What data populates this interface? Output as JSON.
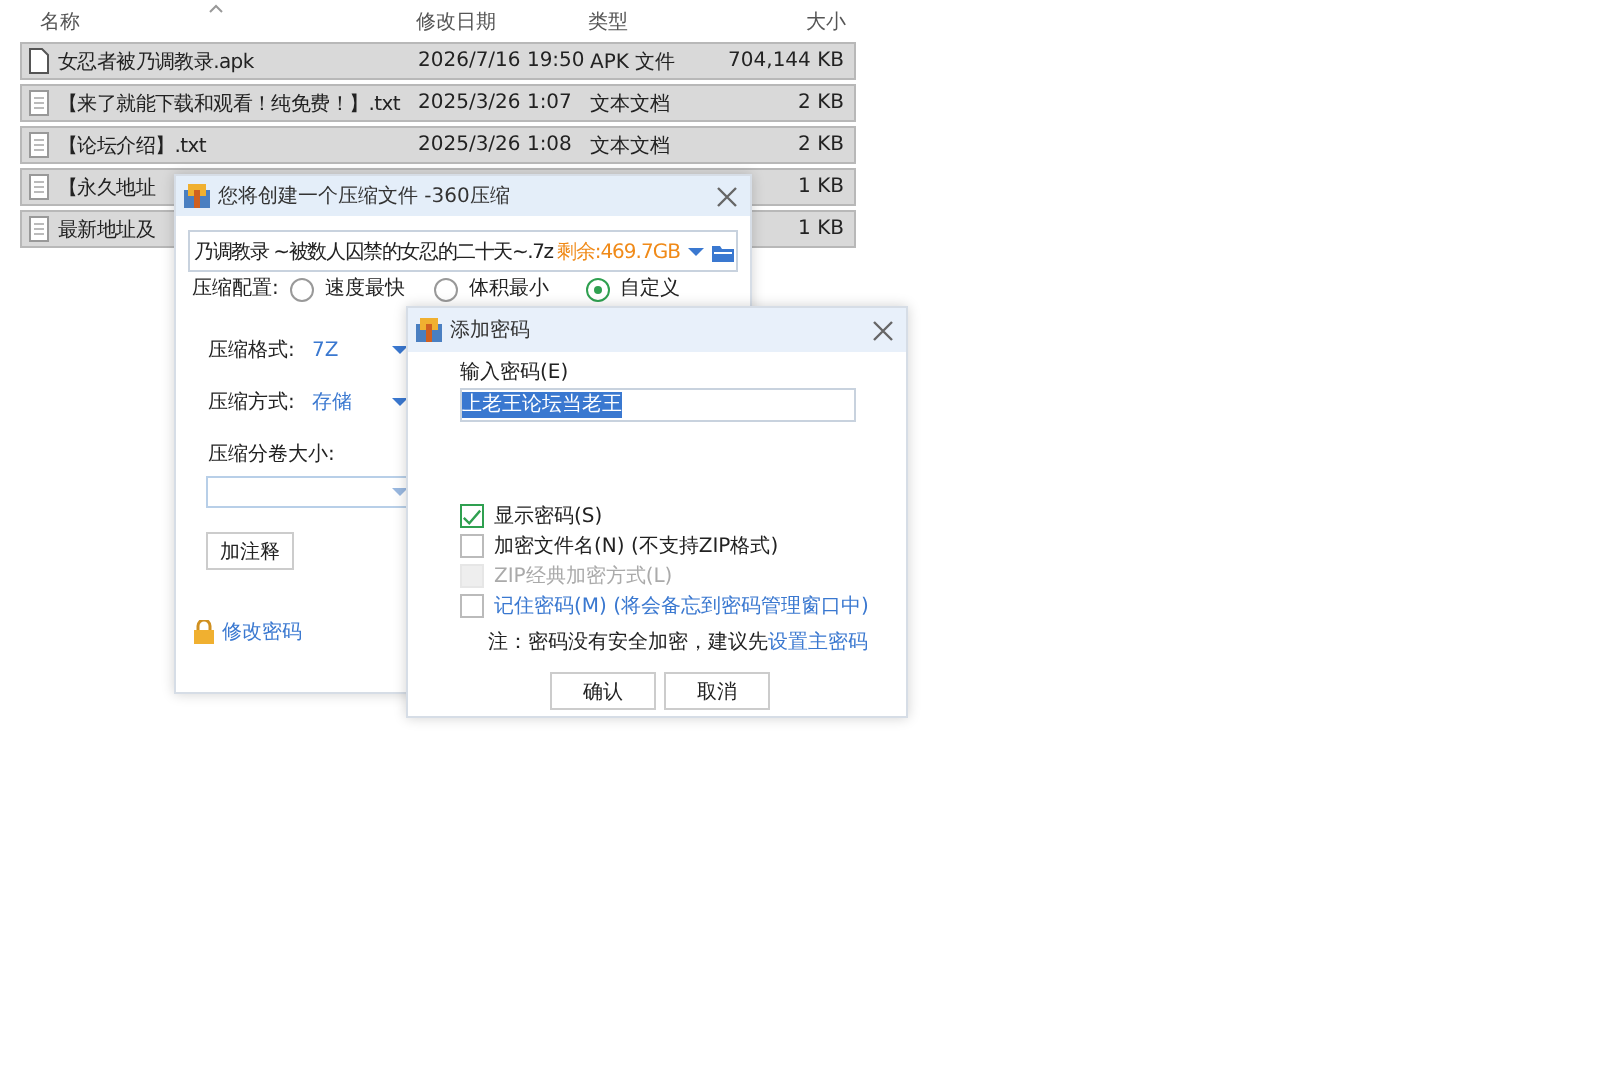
{
  "file_list": {
    "columns": [
      "名称",
      "修改日期",
      "类型",
      "大小"
    ],
    "rows": [
      {
        "kind": "file",
        "name": "女忍者被乃调教录.apk",
        "date": "2026/7/16 19:50",
        "type": "APK 文件",
        "size": "704,144 KB",
        "selected": true
      },
      {
        "kind": "text",
        "name": "【来了就能下载和观看！纯免费！】.txt",
        "date": "2025/3/26 1:07",
        "type": "文本文档",
        "size": "2 KB",
        "selected": true
      },
      {
        "kind": "text",
        "name": "【论坛介绍】.txt",
        "date": "2025/3/26 1:08",
        "type": "文本文档",
        "size": "2 KB",
        "selected": true
      },
      {
        "kind": "text",
        "name": "【永久地址",
        "size": "1 KB",
        "selected": true
      },
      {
        "kind": "text",
        "name": "最新地址及",
        "size": "1 KB",
        "selected": true
      }
    ]
  },
  "compress_dialog": {
    "title": "您将创建一个压缩文件 -360压缩",
    "path": {
      "value": "乃调教录 ~被数人囚禁的女忍的二十天~.7z",
      "free_space": "剩余:469.7GB"
    },
    "config": {
      "label": "压缩配置:",
      "options": [
        {
          "label": "速度最快",
          "selected": false
        },
        {
          "label": "体积最小",
          "selected": false
        },
        {
          "label": "自定义",
          "selected": true
        }
      ]
    },
    "fields": [
      {
        "label": "压缩格式:",
        "value": "7Z"
      },
      {
        "label": "压缩方式:",
        "value": "存储"
      }
    ],
    "split_label": "压缩分卷大小:",
    "comment_button": "加注释",
    "password_link": "修改密码"
  },
  "password_dialog": {
    "title": "添加密码",
    "password": {
      "label": "输入密码(E)",
      "value": "上老王论坛当老王"
    },
    "options": [
      {
        "kind": "plain",
        "label": "显示密码(S)",
        "checked": true,
        "disabled": false
      },
      {
        "kind": "plain",
        "label": "加密文件名(N) (不支持ZIP格式)",
        "checked": false,
        "disabled": false
      },
      {
        "kind": "plain",
        "label": "ZIP经典加密方式(L)",
        "checked": false,
        "disabled": true
      },
      {
        "kind": "link",
        "label": "记住密码(M) (将会备忘到密码管理窗口中)",
        "checked": false,
        "disabled": false
      }
    ],
    "note": {
      "text": "注：密码没有安全加密，建议先",
      "link": "设置主密码"
    },
    "buttons": [
      "确认",
      "取消"
    ]
  }
}
